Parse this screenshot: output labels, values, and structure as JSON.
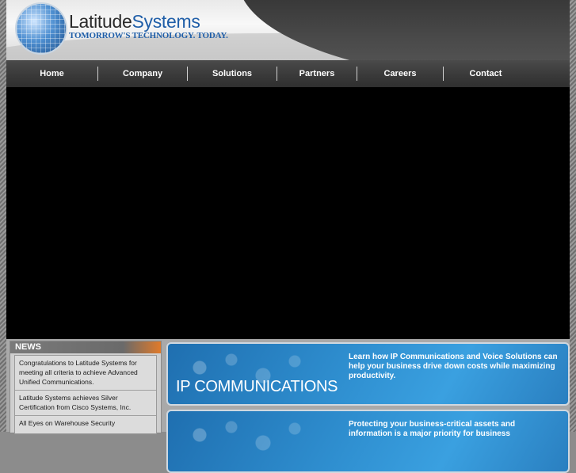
{
  "header": {
    "brand_part1": "Latitude",
    "brand_part2": "Systems",
    "tagline": "TOMORROW'S TECHNOLOGY. TODAY."
  },
  "nav": {
    "items": [
      {
        "label": "Home"
      },
      {
        "label": "Company"
      },
      {
        "label": "Solutions"
      },
      {
        "label": "Partners"
      },
      {
        "label": "Careers"
      },
      {
        "label": "Contact"
      }
    ]
  },
  "news": {
    "title": "NEWS",
    "items": [
      {
        "text": "Congratulations to Latitude Systems for meeting all criteria to achieve Advanced Unified Communications."
      },
      {
        "text": "Latitude Systems achieves Silver Certification from Cisco Systems, Inc."
      },
      {
        "text": "All Eyes on Warehouse Security"
      }
    ]
  },
  "promos": [
    {
      "title": "IP COMMUNICATIONS",
      "text": "Learn how IP Communications and Voice Solutions can help your business drive down costs while maximizing productivity."
    },
    {
      "title": "",
      "text": "Protecting your business-critical assets and information is a major priority for business"
    }
  ]
}
